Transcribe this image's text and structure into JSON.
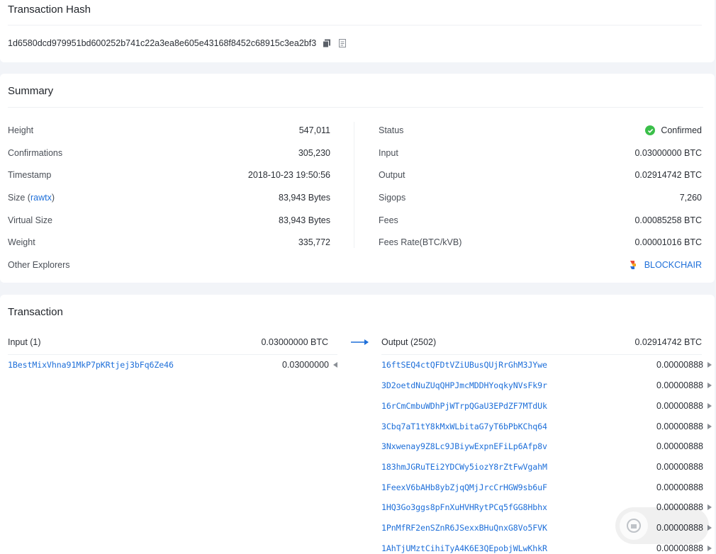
{
  "hash_card": {
    "title": "Transaction Hash",
    "hash": "1d6580dcd979951bd600252b741c22a3ea8e605e43168f8452c68915c3ea2bf3"
  },
  "summary": {
    "title": "Summary",
    "left": [
      {
        "key": "Height",
        "value": "547,011"
      },
      {
        "key": "Confirmations",
        "value": "305,230"
      },
      {
        "key": "Timestamp",
        "value": "2018-10-23 19:50:56"
      },
      {
        "key": "Size",
        "key_link": "rawtx",
        "value": "83,943 Bytes"
      },
      {
        "key": "Virtual Size",
        "value": "83,943 Bytes"
      },
      {
        "key": "Weight",
        "value": "335,772"
      }
    ],
    "right": [
      {
        "key": "Status",
        "value": "Confirmed"
      },
      {
        "key": "Input",
        "value": "0.03000000 BTC"
      },
      {
        "key": "Output",
        "value": "0.02914742 BTC"
      },
      {
        "key": "Sigops",
        "value": "7,260"
      },
      {
        "key": "Fees",
        "value": "0.00085258 BTC"
      },
      {
        "key": "Fees Rate(BTC/kVB)",
        "value": "0.00001016 BTC"
      }
    ],
    "other_explorers_label": "Other Explorers",
    "explorer_link": "BLOCKCHAIR",
    "status_color": "#3bbf4a",
    "link_color": "#1e6fd9"
  },
  "transaction": {
    "title": "Transaction",
    "input_label": "Input (1)",
    "input_total": "0.03000000 BTC",
    "output_label": "Output (2502)",
    "output_total": "0.02914742 BTC",
    "inputs": [
      {
        "address": "1BestMixVhna91MkP7pKRtjej3bFq6Ze46",
        "amount": "0.03000000"
      }
    ],
    "outputs": [
      {
        "address": "16ftSEQ4ctQFDtVZiUBusQUjRrGhM3JYwe",
        "amount": "0.00000888",
        "spent": true
      },
      {
        "address": "3D2oetdNuZUqQHPJmcMDDHYoqkyNVsFk9r",
        "amount": "0.00000888",
        "spent": true
      },
      {
        "address": "16rCmCmbuWDhPjWTrpQGaU3EPdZF7MTdUk",
        "amount": "0.00000888",
        "spent": true
      },
      {
        "address": "3Cbq7aT1tY8kMxWLbitaG7yT6bPbKChq64",
        "amount": "0.00000888",
        "spent": true
      },
      {
        "address": "3Nxwenay9Z8Lc9JBiywExpnEFiLp6Afp8v",
        "amount": "0.00000888",
        "spent": false
      },
      {
        "address": "183hmJGRuTEi2YDCWy5iozY8rZtFwVgahM",
        "amount": "0.00000888",
        "spent": false
      },
      {
        "address": "1FeexV6bAHb8ybZjqQMjJrcCrHGW9sb6uF",
        "amount": "0.00000888",
        "spent": false
      },
      {
        "address": "1HQ3Go3ggs8pFnXuHVHRytPCq5fGG8Hbhx",
        "amount": "0.00000888",
        "spent": true
      },
      {
        "address": "1PnMfRF2enSZnR6JSexxBHuQnxG8Vo5FVK",
        "amount": "0.00000888",
        "spent": true
      },
      {
        "address": "1AhTjUMztCihiTyA4K6E3QEpobjWLwKhkR",
        "amount": "0.00000888",
        "spent": true
      }
    ]
  }
}
